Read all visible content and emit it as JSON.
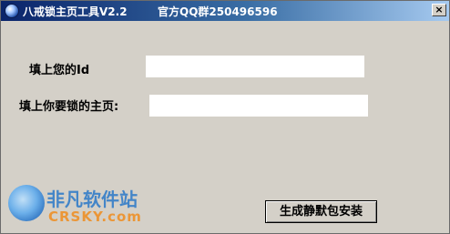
{
  "window": {
    "title": "八戒锁主页工具V2.2",
    "subtitle": "官方QQ群250496596",
    "close_glyph": "×"
  },
  "form": {
    "id_label": "填上您的Id",
    "id_value": "",
    "homepage_label": "填上你要锁的主页:",
    "homepage_value": ""
  },
  "actions": {
    "generate_label": "生成静默包安装"
  },
  "watermark": {
    "brand_cn": "非凡软件站",
    "brand_en": "CRSKY.com"
  },
  "icons": {
    "app_icon": "app-logo-icon",
    "close_icon": "close-icon",
    "watermark_logo": "crsky-logo-icon"
  },
  "colors": {
    "title_bar_start": "#0a246a",
    "title_bar_end": "#a6caf0",
    "window_bg": "#d4d0c8",
    "input_bg": "#ffffff"
  }
}
